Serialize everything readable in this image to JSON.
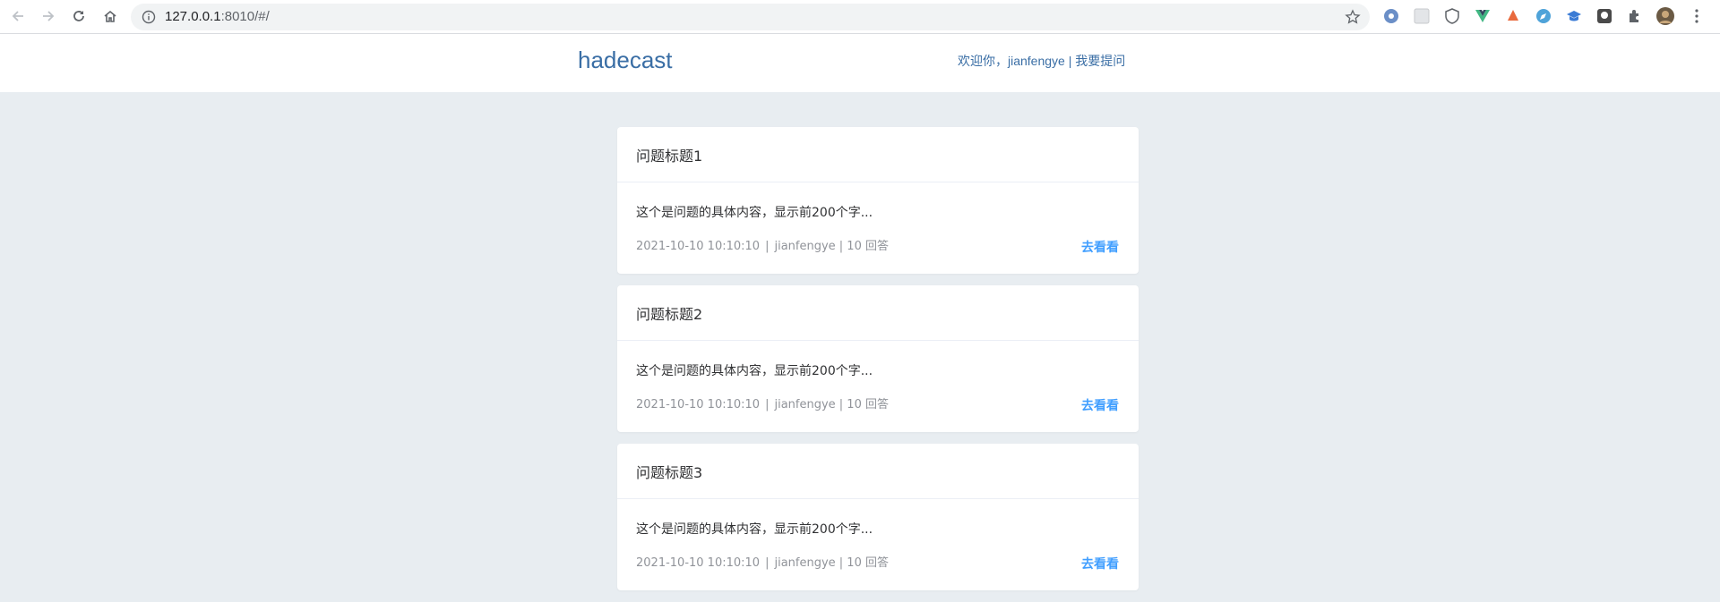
{
  "browser": {
    "url_host": "127.0.0.1",
    "url_rest": ":8010/#/"
  },
  "header": {
    "brand": "hadecast",
    "welcome": "欢迎你，jianfengye",
    "divider": " | ",
    "ask_label": "我要提问"
  },
  "questions": [
    {
      "title": "问题标题1",
      "excerpt": "这个是问题的具体内容，显示前200个字...",
      "time": "2021-10-10 10:10:10",
      "author_answers": "jianfengye | 10 回答",
      "action": "去看看"
    },
    {
      "title": "问题标题2",
      "excerpt": "这个是问题的具体内容，显示前200个字...",
      "time": "2021-10-10 10:10:10",
      "author_answers": "jianfengye | 10 回答",
      "action": "去看看"
    },
    {
      "title": "问题标题3",
      "excerpt": "这个是问题的具体内容，显示前200个字...",
      "time": "2021-10-10 10:10:10",
      "author_answers": "jianfengye | 10 回答",
      "action": "去看看"
    }
  ],
  "meta_separator": "|",
  "colors": {
    "brand": "#3a6ea5",
    "link": "#409eff",
    "background": "#e8edf1"
  }
}
